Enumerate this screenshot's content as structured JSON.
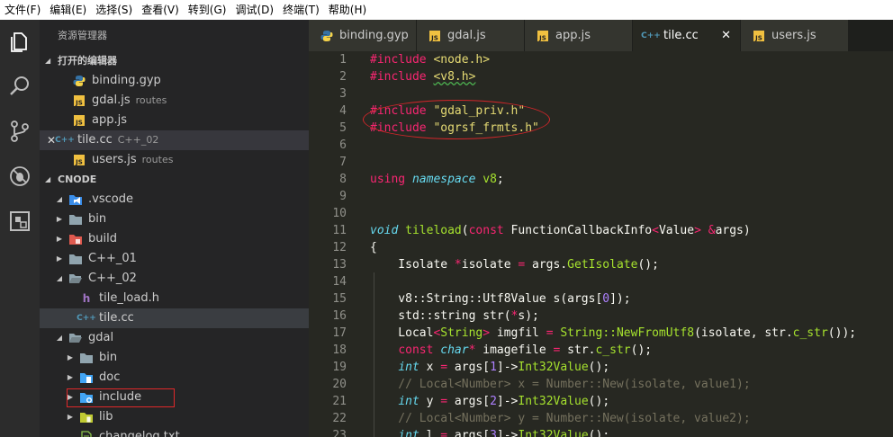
{
  "menubar": {
    "items": [
      "文件(F)",
      "编辑(E)",
      "选择(S)",
      "查看(V)",
      "转到(G)",
      "调试(D)",
      "终端(T)",
      "帮助(H)"
    ]
  },
  "activity_bar": {
    "icons": [
      "files-icon",
      "search-icon",
      "source-control-icon",
      "debug-icon",
      "extensions-icon"
    ]
  },
  "sidebar": {
    "title": "资源管理器",
    "open_editors": {
      "label": "打开的编辑器",
      "items": [
        {
          "name": "binding.gyp",
          "desc": "",
          "icon": "python-icon",
          "icon_color": "#3572A5"
        },
        {
          "name": "gdal.js",
          "desc": "routes",
          "icon": "js-icon",
          "icon_color": "#f0c040"
        },
        {
          "name": "app.js",
          "desc": "",
          "icon": "js-icon",
          "icon_color": "#f0c040"
        },
        {
          "name": "tile.cc",
          "desc": "C++_02",
          "icon": "cpp-icon",
          "icon_color": "#519aba"
        },
        {
          "name": "users.js",
          "desc": "routes",
          "icon": "js-icon",
          "icon_color": "#f0c040"
        }
      ]
    },
    "project": {
      "label": "CNODE",
      "tree": [
        {
          "name": ".vscode",
          "depth": 1,
          "open": true,
          "icon": "vscode-folder-icon",
          "icon_color": "#3b8eea"
        },
        {
          "name": "bin",
          "depth": 1,
          "open": false,
          "icon": "folder-icon",
          "icon_color": "#90a4ae"
        },
        {
          "name": "build",
          "depth": 1,
          "open": false,
          "icon": "build-folder-icon",
          "icon_color": "#e05a4f"
        },
        {
          "name": "C++_01",
          "depth": 1,
          "open": false,
          "icon": "folder-icon",
          "icon_color": "#90a4ae"
        },
        {
          "name": "C++_02",
          "depth": 1,
          "open": true,
          "icon": "folder-open-icon",
          "icon_color": "#90a4ae"
        },
        {
          "name": "tile_load.h",
          "depth": 2,
          "icon": "h-file-icon",
          "icon_color": "#a074c4"
        },
        {
          "name": "tile.cc",
          "depth": 2,
          "icon": "cpp-icon",
          "icon_color": "#519aba"
        },
        {
          "name": "gdal",
          "depth": 1,
          "open": true,
          "icon": "folder-open-icon",
          "icon_color": "#90a4ae"
        },
        {
          "name": "bin",
          "depth": 2,
          "open": false,
          "icon": "folder-icon",
          "icon_color": "#90a4ae"
        },
        {
          "name": "doc",
          "depth": 2,
          "open": false,
          "icon": "doc-folder-icon",
          "icon_color": "#42a5f5"
        },
        {
          "name": "include",
          "depth": 2,
          "open": false,
          "icon": "include-folder-icon",
          "icon_color": "#42a5f5"
        },
        {
          "name": "lib",
          "depth": 2,
          "open": false,
          "icon": "lib-folder-icon",
          "icon_color": "#c0ca33"
        },
        {
          "name": "changelog.txt",
          "depth": 2,
          "icon": "text-file-icon",
          "icon_color": "#8bc34a"
        }
      ]
    }
  },
  "tabs": [
    {
      "name": "binding.gyp",
      "icon": "python-icon",
      "icon_color": "#3572A5",
      "active": false
    },
    {
      "name": "gdal.js",
      "icon": "js-icon",
      "icon_color": "#f0c040",
      "active": false
    },
    {
      "name": "app.js",
      "icon": "js-icon",
      "icon_color": "#f0c040",
      "active": false
    },
    {
      "name": "tile.cc",
      "icon": "cpp-icon",
      "icon_color": "#519aba",
      "active": true,
      "close": "✕"
    },
    {
      "name": "users.js",
      "icon": "js-icon",
      "icon_color": "#f0c040",
      "active": false
    }
  ],
  "code": {
    "lines": [
      {
        "n": "1",
        "tokens": [
          [
            "kw",
            "#include"
          ],
          [
            "pl",
            " "
          ],
          [
            "str",
            "<node.h>"
          ]
        ]
      },
      {
        "n": "2",
        "tokens": [
          [
            "kw",
            "#include"
          ],
          [
            "pl",
            " "
          ],
          [
            "str",
            "<v8.h>"
          ]
        ]
      },
      {
        "n": "3",
        "tokens": []
      },
      {
        "n": "4",
        "tokens": [
          [
            "kw",
            "#include"
          ],
          [
            "pl",
            " "
          ],
          [
            "str",
            "\"gdal_priv.h\""
          ]
        ]
      },
      {
        "n": "5",
        "tokens": [
          [
            "kw",
            "#include"
          ],
          [
            "pl",
            " "
          ],
          [
            "str",
            "\"ogrsf_frmts.h\""
          ]
        ]
      },
      {
        "n": "6",
        "tokens": []
      },
      {
        "n": "7",
        "tokens": []
      },
      {
        "n": "8",
        "tokens": [
          [
            "kw",
            "using"
          ],
          [
            "pl",
            " "
          ],
          [
            "ty",
            "namespace"
          ],
          [
            "pl",
            " "
          ],
          [
            "fn",
            "v8"
          ],
          [
            "pl",
            ";"
          ]
        ]
      },
      {
        "n": "9",
        "tokens": []
      },
      {
        "n": "10",
        "tokens": []
      },
      {
        "n": "11",
        "tokens": [
          [
            "ty",
            "void"
          ],
          [
            "pl",
            " "
          ],
          [
            "fn",
            "tileload"
          ],
          [
            "pl",
            "("
          ],
          [
            "kw",
            "const"
          ],
          [
            "pl",
            " FunctionCallbackInfo"
          ],
          [
            "kw",
            "<"
          ],
          [
            "pl",
            "Value"
          ],
          [
            "kw",
            "> &"
          ],
          [
            "pl",
            "args)"
          ]
        ]
      },
      {
        "n": "12",
        "tokens": [
          [
            "pl",
            "{"
          ]
        ]
      },
      {
        "n": "13",
        "tokens": [
          [
            "pl",
            "    Isolate "
          ],
          [
            "kw",
            "*"
          ],
          [
            "pl",
            "isolate "
          ],
          [
            "kw",
            "="
          ],
          [
            "pl",
            " args."
          ],
          [
            "fn",
            "GetIsolate"
          ],
          [
            "pl",
            "();"
          ]
        ]
      },
      {
        "n": "14",
        "tokens": []
      },
      {
        "n": "15",
        "tokens": [
          [
            "pl",
            "    v8::String::Utf8Value s(args["
          ],
          [
            "num",
            "0"
          ],
          [
            "pl",
            "]);"
          ]
        ]
      },
      {
        "n": "16",
        "tokens": [
          [
            "pl",
            "    std::string str("
          ],
          [
            "kw",
            "*"
          ],
          [
            "pl",
            "s);"
          ]
        ]
      },
      {
        "n": "17",
        "tokens": [
          [
            "pl",
            "    Local"
          ],
          [
            "kw",
            "<"
          ],
          [
            "fn",
            "String"
          ],
          [
            "kw",
            "> "
          ],
          [
            "pl",
            "imgfil "
          ],
          [
            "kw",
            "="
          ],
          [
            "pl",
            " "
          ],
          [
            "fn",
            "String::NewFromUtf8"
          ],
          [
            "pl",
            "(isolate, str."
          ],
          [
            "fn",
            "c_str"
          ],
          [
            "pl",
            "());"
          ]
        ]
      },
      {
        "n": "18",
        "tokens": [
          [
            "pl",
            "    "
          ],
          [
            "kw",
            "const"
          ],
          [
            "pl",
            " "
          ],
          [
            "ty",
            "char"
          ],
          [
            "kw",
            "*"
          ],
          [
            "pl",
            " imagefile "
          ],
          [
            "kw",
            "="
          ],
          [
            "pl",
            " str."
          ],
          [
            "fn",
            "c_str"
          ],
          [
            "pl",
            "();"
          ]
        ]
      },
      {
        "n": "19",
        "tokens": [
          [
            "pl",
            "    "
          ],
          [
            "ty",
            "int"
          ],
          [
            "pl",
            " x "
          ],
          [
            "kw",
            "="
          ],
          [
            "pl",
            " args["
          ],
          [
            "num",
            "1"
          ],
          [
            "pl",
            "]->"
          ],
          [
            "fn",
            "Int32Value"
          ],
          [
            "pl",
            "();"
          ]
        ]
      },
      {
        "n": "20",
        "tokens": [
          [
            "cm",
            "    // Local<Number> x = Number::New(isolate, value1);"
          ]
        ]
      },
      {
        "n": "21",
        "tokens": [
          [
            "pl",
            "    "
          ],
          [
            "ty",
            "int"
          ],
          [
            "pl",
            " y "
          ],
          [
            "kw",
            "="
          ],
          [
            "pl",
            " args["
          ],
          [
            "num",
            "2"
          ],
          [
            "pl",
            "]->"
          ],
          [
            "fn",
            "Int32Value"
          ],
          [
            "pl",
            "();"
          ]
        ]
      },
      {
        "n": "22",
        "tokens": [
          [
            "cm",
            "    // Local<Number> y = Number::New(isolate, value2);"
          ]
        ]
      },
      {
        "n": "23",
        "tokens": [
          [
            "pl",
            "    "
          ],
          [
            "ty",
            "int"
          ],
          [
            "pl",
            " l "
          ],
          [
            "kw",
            "="
          ],
          [
            "pl",
            " args["
          ],
          [
            "num",
            "3"
          ],
          [
            "pl",
            "]->"
          ],
          [
            "fn",
            "Int32Value"
          ],
          [
            "pl",
            "();"
          ]
        ]
      }
    ]
  }
}
